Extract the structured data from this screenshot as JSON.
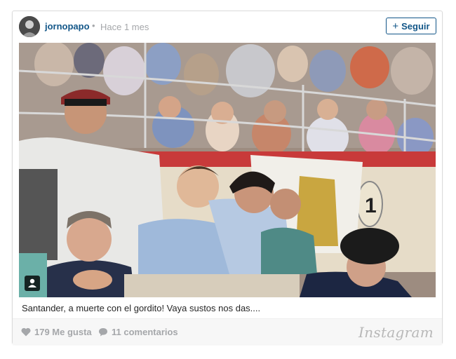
{
  "post": {
    "username": "jornopapo",
    "separator": "•",
    "timestamp": "Hace 1 mes",
    "follow_label": "Seguir",
    "caption": "Santander, a muerte con el gordito! Vaya sustos nos das....",
    "likes": "179 Me gusta",
    "comments": "11 comentarios",
    "brand": "Instagram"
  },
  "icons": {
    "avatar": "user-avatar",
    "follow": "plus-icon",
    "tag": "person-tag-icon",
    "like": "heart-icon",
    "comment": "speech-bubble-icon"
  },
  "colors": {
    "link_blue": "#125688",
    "muted_gray": "#a5a7aa",
    "footer_bg": "#f7f7f7",
    "border": "#dbdbdb"
  }
}
